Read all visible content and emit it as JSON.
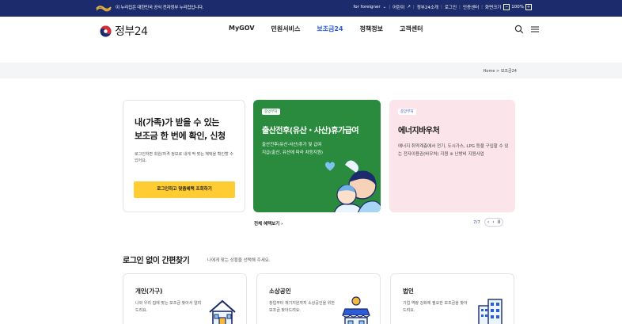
{
  "topbar": {
    "gov_notice": "이 누리집은 대한민국 공식 전자정부 누리집입니다.",
    "links": [
      "for foreigner",
      "어린이",
      "정부24소개",
      "로그인",
      "인증센터",
      "화면크기"
    ],
    "zoom": "100%",
    "zoom_minus": "−",
    "zoom_plus": "+"
  },
  "header": {
    "logo_text": "정부24",
    "nav": [
      "MyGOV",
      "민원서비스",
      "보조금24",
      "정책정보",
      "고객센터"
    ],
    "active_nav": "보조금24"
  },
  "breadcrumb": {
    "home": "Home",
    "sep": ">",
    "current": "보조금24"
  },
  "login_card": {
    "title_line1": "내(가족)가 받을 수 있는",
    "title_line2": "보조금 한 번에 확인, 신청",
    "desc": "로그인하면 회원/자격 정보로 내게 딱 맞는 혜택을 확인할 수 있어요.",
    "button": "로그인하고 맞춤혜택 조회하기"
  },
  "benefit_cards": [
    {
      "tag": "중앙부처",
      "title": "출산전후(유산・사산)휴가급여",
      "desc": "출산전후(유산·사산)휴가 및 급여 지급(출산, 유산에 따라 차등지원)"
    },
    {
      "tag": "중앙부처",
      "title": "에너지바우처",
      "desc": "에너지 취약계층에서 전기, 도시가스, LPG 등을 구입할 수 있는 전자이용권(바우처) 지원 ※ 난방비 지원사업"
    }
  ],
  "see_all": "전체 혜택보기",
  "pager": {
    "current": "7",
    "total": "7",
    "prev": "‹",
    "next": "›",
    "pause": "II"
  },
  "quick_find": {
    "title": "로그인 없이 간편찾기",
    "subtitle": "나에게 맞는 상황을 선택해 주세요.",
    "cards": [
      {
        "name": "개인(가구)",
        "desc": "나와 우리 집에 맞는 보조금 찾아서 알려드려요.",
        "icon": "house-icon"
      },
      {
        "name": "소상공인",
        "desc": "창업부터 재기지원까지 소상공인을 위한 보조금 찾아드려요.",
        "icon": "store-icon"
      },
      {
        "name": "법인",
        "desc": "기업 역량 강화에 필요한 보조금을 찾아드려요.",
        "icon": "building-icon"
      }
    ]
  },
  "colors": {
    "topbar": "#1c2b6b",
    "accent_blue": "#2b5bd7",
    "card_green": "#2a8a3e",
    "card_pink": "#fbe4ea",
    "login_button": "#ffcc33"
  }
}
